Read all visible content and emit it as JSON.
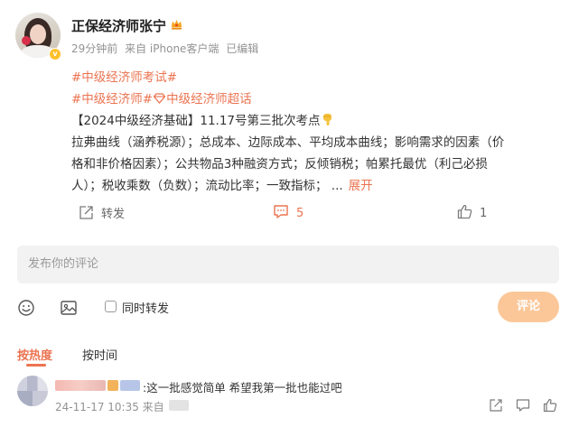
{
  "post": {
    "author": {
      "name": "正保经济师张宁",
      "crown_icon": "crown-icon",
      "verified_icon": "verified-badge-icon"
    },
    "meta": {
      "time": "29分钟前",
      "source": "来自 iPhone客户端",
      "edited": "已编辑"
    },
    "tags": {
      "tag1": "#中级经济师考试#",
      "tag2": "#中级经济师#",
      "tag3": "中级经济师超话"
    },
    "content": {
      "line1": "【2024中级经济基础】11.17号第三批次考点",
      "line2": "拉弗曲线（涵养税源）；总成本、边际成本、平均成本曲线；影响需求的因素（价",
      "line3": "格和非价格因素）；公共物品3种融资方式；反倾销税；帕累托最优（利己必损",
      "line4": "人）；税收乘数（负数）；流动比率；一致指标；  ...",
      "expand": "展开"
    },
    "actions": {
      "forward_label": "转发",
      "comment_count": "5",
      "like_count": "1"
    }
  },
  "compose": {
    "placeholder": "发布你的评论",
    "also_forward_label": "同时转发",
    "submit_label": "评论"
  },
  "sort": {
    "hot_label": "按热度",
    "time_label": "按时间"
  },
  "comment": {
    "text": ":这一批感觉简单 希望我第一批也能过吧",
    "time": "24-11-17 10:35 来自"
  },
  "colors": {
    "accent": "#eb7350",
    "submit_disabled": "#fbc799",
    "meta_gray": "#939393"
  }
}
